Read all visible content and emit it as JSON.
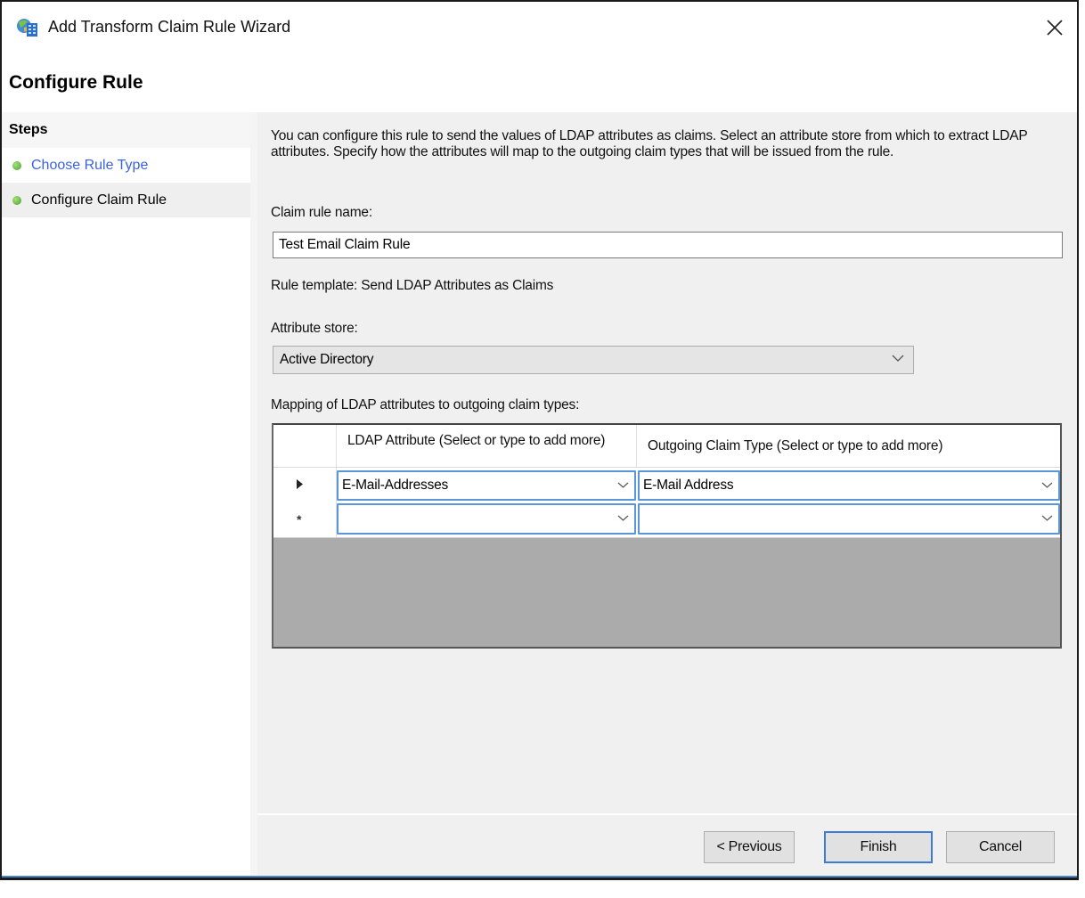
{
  "window": {
    "title": "Add Transform Claim Rule Wizard",
    "icon": "claims-wizard-icon",
    "close_icon": "close-icon"
  },
  "header": {
    "page_title": "Configure Rule"
  },
  "sidebar": {
    "heading": "Steps",
    "steps": [
      {
        "label": "Choose Rule Type",
        "state": "link",
        "status_color": "#48a132"
      },
      {
        "label": "Configure Claim Rule",
        "state": "current",
        "status_color": "#48a132"
      }
    ]
  },
  "main": {
    "intro": "You can configure this rule to send the values of LDAP attributes as claims. Select an attribute store from which to extract LDAP attributes. Specify how the attributes will map to the outgoing claim types that will be issued from the rule.",
    "claim_rule_name_label": "Claim rule name:",
    "claim_rule_name_value": "Test Email Claim Rule",
    "rule_template": "Rule template: Send LDAP Attributes as Claims",
    "attribute_store_label": "Attribute store:",
    "attribute_store_value": "Active Directory",
    "mapping_label": "Mapping of LDAP attributes to outgoing claim types:",
    "mapping_grid": {
      "columns": [
        "LDAP Attribute (Select or type to add more)",
        "Outgoing Claim Type (Select or type to add more)"
      ],
      "rows": [
        {
          "indicator": "▶",
          "ldap_attribute": "E-Mail-Addresses",
          "outgoing_claim_type": "E-Mail Address"
        },
        {
          "indicator": "*",
          "ldap_attribute": "",
          "outgoing_claim_type": ""
        }
      ]
    }
  },
  "footer": {
    "previous_label": "< Previous",
    "finish_label": "Finish",
    "cancel_label": "Cancel"
  },
  "colors": {
    "accent_border": "#3d7bd6",
    "link": "#3a63e0",
    "grid_empty": "#ababab"
  }
}
